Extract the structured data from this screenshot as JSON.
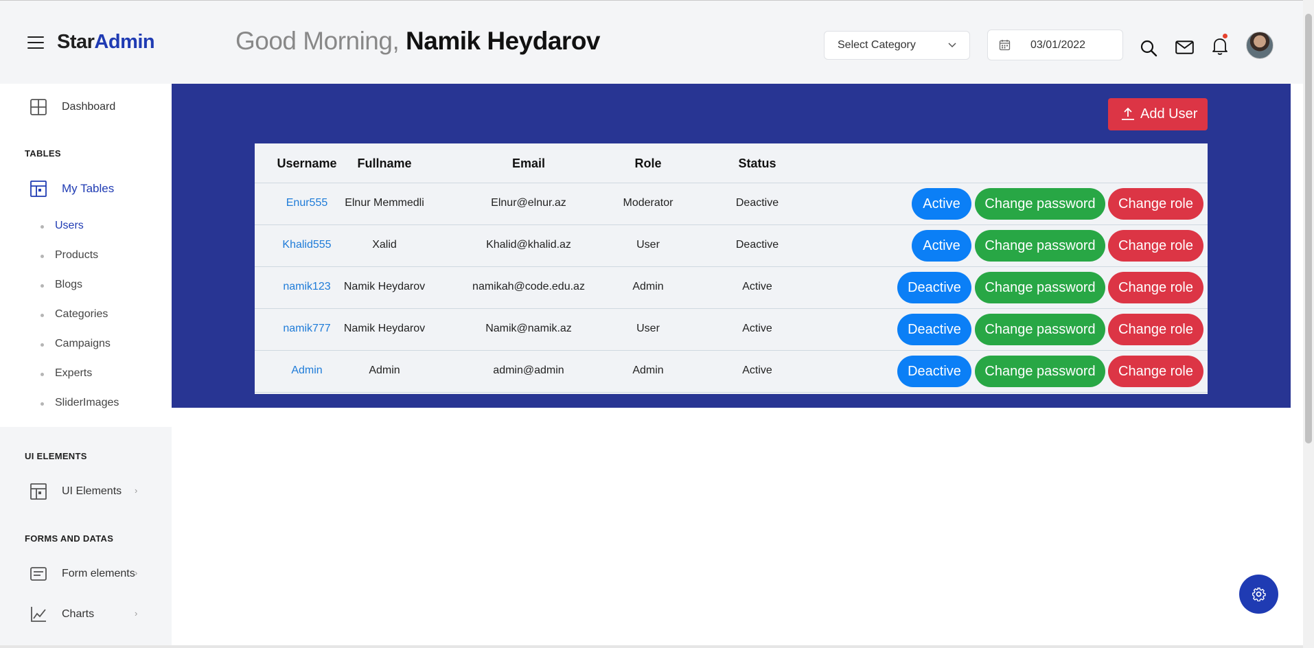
{
  "app": {
    "logo_star": "Star",
    "logo_admin": "Admin"
  },
  "header": {
    "greeting": "Good Morning,",
    "user_name": "Namik Heydarov",
    "category_select": "Select Category",
    "date": "03/01/2022"
  },
  "sidebar": {
    "dashboard": "Dashboard",
    "section_tables": "TABLES",
    "my_tables": "My Tables",
    "sub_items": [
      "Users",
      "Products",
      "Blogs",
      "Categories",
      "Campaigns",
      "Experts",
      "SliderImages"
    ],
    "section_ui": "UI ELEMENTS",
    "ui_elements": "UI Elements",
    "section_forms": "FORMS AND DATAS",
    "form_elements": "Form elements",
    "charts": "Charts",
    "arrow": "›"
  },
  "main": {
    "add_user": "Add User",
    "columns": [
      "Username",
      "Fullname",
      "Email",
      "Role",
      "Status"
    ],
    "rows": [
      {
        "username": "Enur555",
        "fullname": "Elnur Memmedli",
        "email": "Elnur@elnur.az",
        "role": "Moderator",
        "status": "Deactive",
        "toggle": "Active",
        "change_password": "Change password",
        "change_role": "Change role"
      },
      {
        "username": "Khalid555",
        "fullname": "Xalid",
        "email": "Khalid@khalid.az",
        "role": "User",
        "status": "Deactive",
        "toggle": "Active",
        "change_password": "Change password",
        "change_role": "Change role"
      },
      {
        "username": "namik123",
        "fullname": "Namik Heydarov",
        "email": "namikah@code.edu.az",
        "role": "Admin",
        "status": "Active",
        "toggle": "Deactive",
        "change_password": "Change password",
        "change_role": "Change role"
      },
      {
        "username": "namik777",
        "fullname": "Namik Heydarov",
        "email": "Namik@namik.az",
        "role": "User",
        "status": "Active",
        "toggle": "Deactive",
        "change_password": "Change password",
        "change_role": "Change role"
      },
      {
        "username": "Admin",
        "fullname": "Admin",
        "email": "admin@admin",
        "role": "Admin",
        "status": "Active",
        "toggle": "Deactive",
        "change_password": "Change password",
        "change_role": "Change role"
      }
    ]
  },
  "colors": {
    "brand": "#1f3bb3",
    "panel": "#283593",
    "blue_button": "#0b7ff6",
    "green_button": "#28a745",
    "red_button": "#dc3545"
  },
  "icons": {
    "menu": "hamburger-icon",
    "search": "search-icon",
    "mail": "mail-icon",
    "bell": "bell-icon",
    "calendar": "calendar-icon",
    "settings": "gear-icon"
  }
}
